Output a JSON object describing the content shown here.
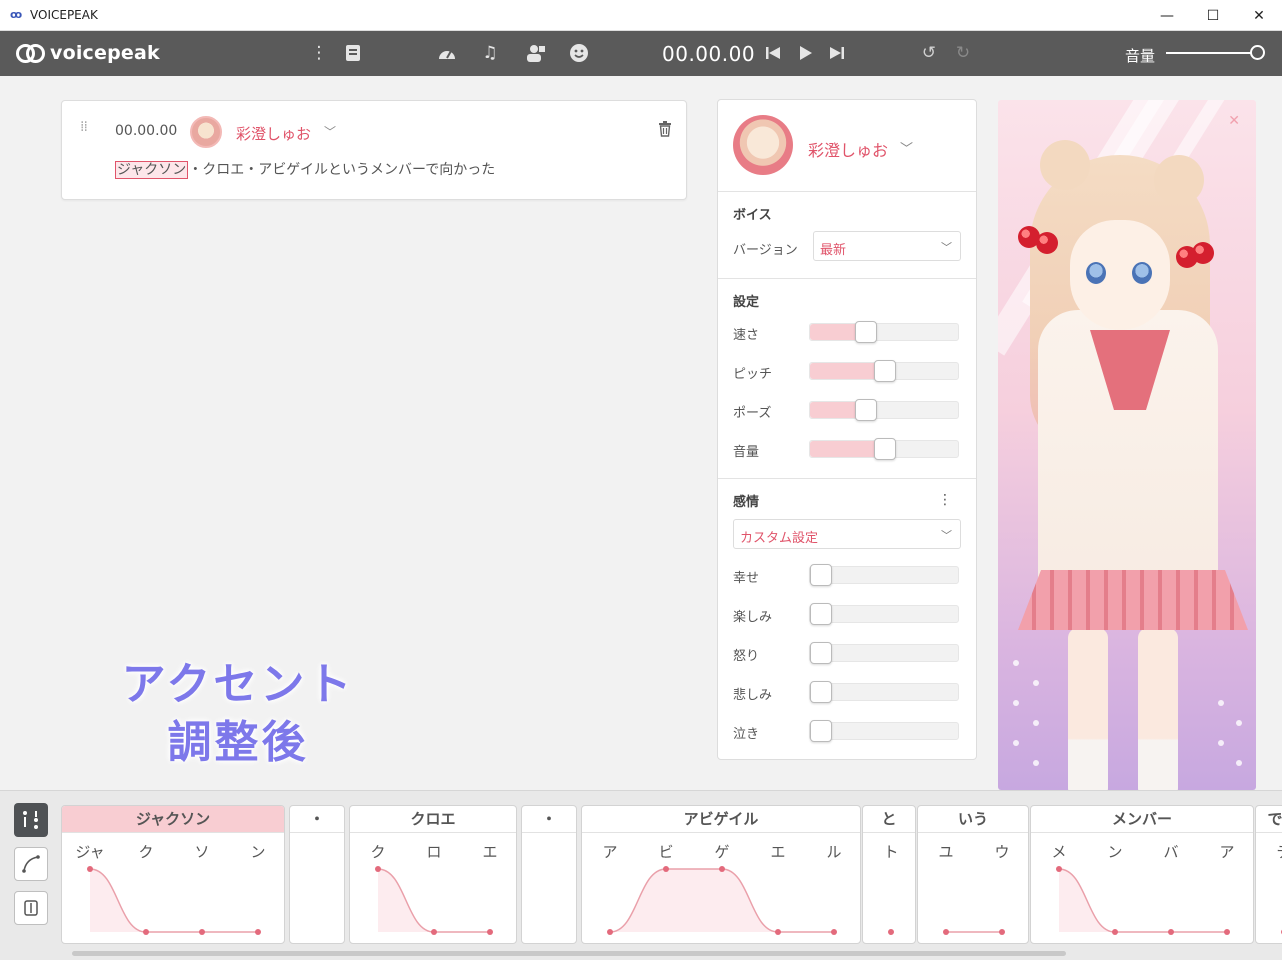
{
  "window": {
    "title": "VOICEPEAK",
    "minimize": "—",
    "maximize": "☐",
    "close": "✕"
  },
  "toolbar": {
    "logo": "voicepeak",
    "time": "00.00.00",
    "volume_label": "音量",
    "icons": [
      "more-vertical-icon",
      "book-icon",
      "speedometer-icon",
      "music-note-icon",
      "person-settings-icon",
      "smile-icon",
      "skip-back-icon",
      "play-icon",
      "skip-forward-icon",
      "undo-icon",
      "redo-icon"
    ]
  },
  "line": {
    "time": "00.00.00",
    "speaker": "彩澄しゅお",
    "text_highlight": "ジャクソン",
    "text_rest": "・クロエ・アビゲイルというメンバーで向かった"
  },
  "overlay": {
    "line1": "アクセント",
    "line2": "調整後"
  },
  "settings": {
    "speaker": "彩澄しゅお",
    "voice_title": "ボイス",
    "version_label": "バージョン",
    "version_value": "最新",
    "params_title": "設定",
    "params": [
      {
        "label": "速さ",
        "value": 0.35
      },
      {
        "label": "ピッチ",
        "value": 0.5
      },
      {
        "label": "ポーズ",
        "value": 0.35
      },
      {
        "label": "音量",
        "value": 0.5
      }
    ],
    "emotion_title": "感情",
    "emotion_preset": "カスタム設定",
    "emotions": [
      {
        "label": "幸せ",
        "value": 0
      },
      {
        "label": "楽しみ",
        "value": 0
      },
      {
        "label": "怒り",
        "value": 0
      },
      {
        "label": "悲しみ",
        "value": 0
      },
      {
        "label": "泣き",
        "value": 0
      }
    ]
  },
  "accent": {
    "chunks": [
      {
        "label": "ジャクソン",
        "moras": [
          "ジャ",
          "ク",
          "ソ",
          "ン"
        ],
        "selected": true
      },
      {
        "label": "・",
        "moras": []
      },
      {
        "label": "クロエ",
        "moras": [
          "ク",
          "ロ",
          "エ"
        ]
      },
      {
        "label": "・",
        "moras": []
      },
      {
        "label": "アビゲイル",
        "moras": [
          "ア",
          "ビ",
          "ゲ",
          "エ",
          "ル"
        ]
      },
      {
        "label": "と",
        "moras": [
          "ト"
        ]
      },
      {
        "label": "いう",
        "moras": [
          "ユ",
          "ウ"
        ]
      },
      {
        "label": "メンバー",
        "moras": [
          "メ",
          "ン",
          "バ",
          "ア"
        ]
      },
      {
        "label": "で",
        "moras": [
          "デ"
        ]
      }
    ]
  }
}
